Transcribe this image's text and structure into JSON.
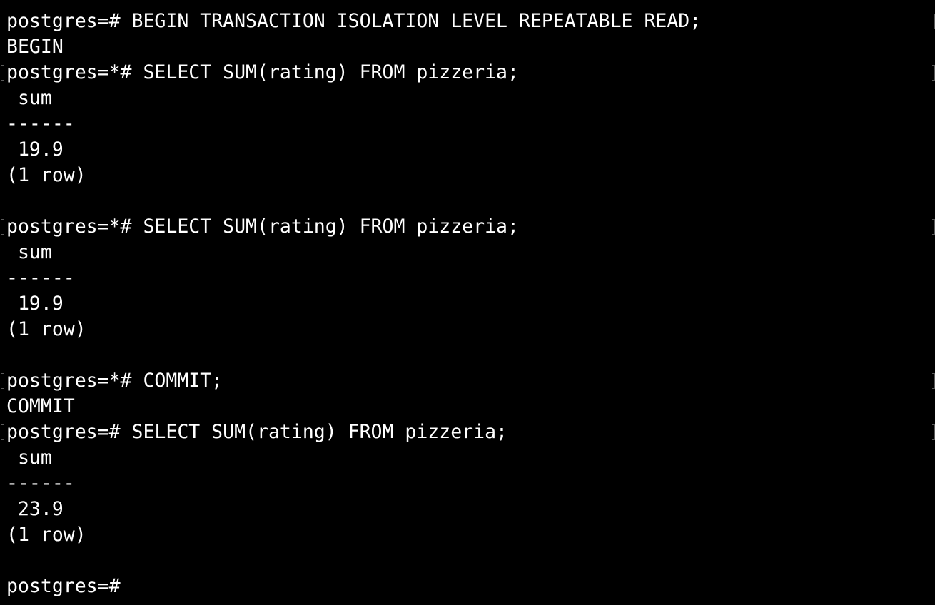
{
  "terminal": {
    "lines": [
      "postgres=# BEGIN TRANSACTION ISOLATION LEVEL REPEATABLE READ;",
      "BEGIN",
      "postgres=*# SELECT SUM(rating) FROM pizzeria;",
      " sum",
      "------",
      " 19.9",
      "(1 row)",
      "",
      "postgres=*# SELECT SUM(rating) FROM pizzeria;",
      " sum",
      "------",
      " 19.9",
      "(1 row)",
      "",
      "postgres=*# COMMIT;",
      "COMMIT",
      "postgres=# SELECT SUM(rating) FROM pizzeria;",
      " sum",
      "------",
      " 23.9",
      "(1 row)",
      "",
      "postgres=# "
    ]
  },
  "colors": {
    "background": "#000000",
    "foreground": "#ffffff",
    "mark": "#5a5a5a"
  }
}
